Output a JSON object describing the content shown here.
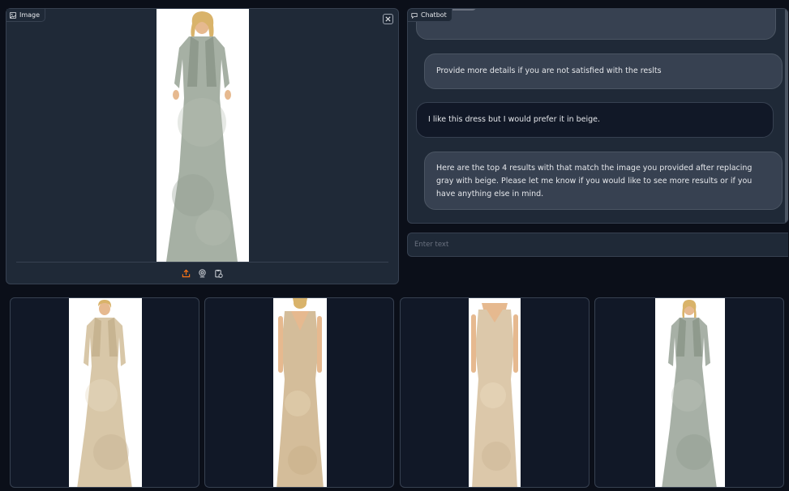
{
  "image_panel": {
    "label": "Image",
    "photo_alt": "Gray sequin lace long dress with jacket",
    "toolbar": [
      "upload-icon",
      "webcam-icon",
      "clipboard-icon"
    ]
  },
  "chatbot": {
    "label": "Chatbot",
    "messages": [
      {
        "role": "bot",
        "text": ""
      },
      {
        "role": "bot",
        "text": "Provide more details if you are not satisfied with the reslts"
      },
      {
        "role": "user",
        "text": "I like this dress but I would prefer it in beige."
      },
      {
        "role": "bot",
        "text": "Here are the top 4 results with that match the image you provided after replacing gray with beige. Please let me know if you would like to see more results or if you have anything else in mind."
      }
    ]
  },
  "input": {
    "placeholder": "Enter text",
    "value": ""
  },
  "gallery": [
    {
      "alt": "Beige lace gown with jacket",
      "color": "#d8c7a8"
    },
    {
      "alt": "Beige sleeveless lace gown, back view",
      "color": "#d4bd9a"
    },
    {
      "alt": "Beige sleeveless lace gown, front view",
      "color": "#dcc8aa"
    },
    {
      "alt": "Gray lace gown with jacket",
      "color": "#a7b0a6"
    }
  ],
  "colors": {
    "accent": "#f97316",
    "background": "#0b0f19",
    "panel": "#1f2937"
  }
}
